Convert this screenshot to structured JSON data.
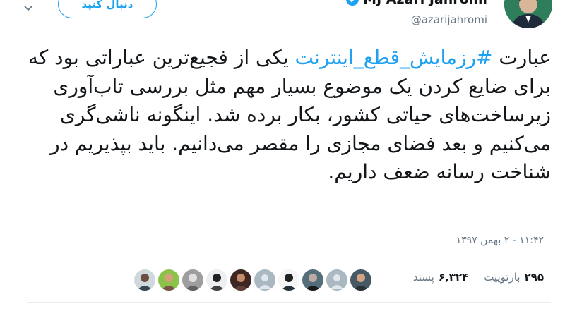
{
  "header": {
    "follow_label": "دنبال کنید",
    "display_name": "MJ Azari Jahromi",
    "handle": "@azarijahromi"
  },
  "tweet": {
    "text_before": "عبارت ",
    "hashtag": "#رزمایش_قطع_اینترنت",
    "text_after": " یکی از فجیع‌ترین عباراتی بود که برای ضایع کردن یک موضوع بسیار مهم مثل بررسی تاب‌آوری زیرساخت‌های حیاتی کشور، بکار برده شد. اینگونه ناشی‌گری می‌کنیم و بعد فضای مجازی را مقصر می‌دانیم. باید بپذیریم در شناخت رسانه ضعف داریم.",
    "timestamp": "۱۱:۴۲ - ۲ بهمن ۱۳۹۷"
  },
  "stats": {
    "retweets_count": "۲۹۵",
    "retweets_label": "بازتوییت",
    "likes_count": "۶,۳۲۴",
    "likes_label": "پسند"
  },
  "colors": {
    "accent": "#1da1f2",
    "text": "#14171a",
    "muted": "#657786",
    "divider": "#e6ecf0"
  }
}
